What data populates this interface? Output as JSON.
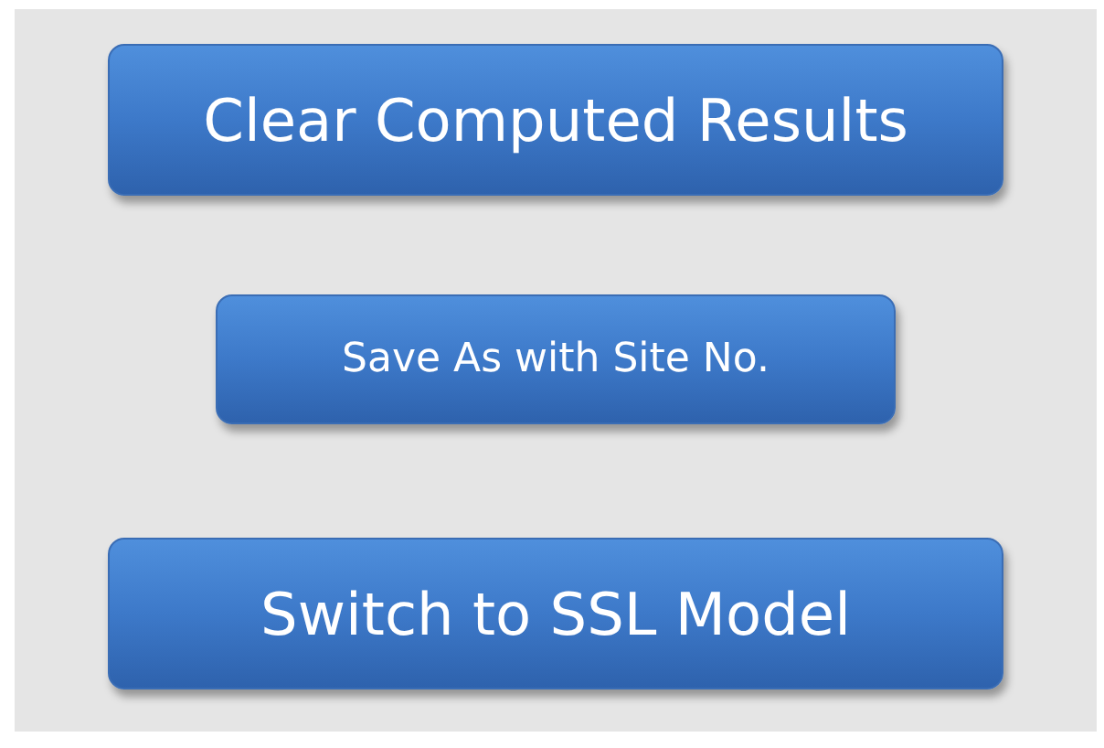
{
  "buttons": [
    {
      "label": "Clear Computed Results",
      "kind": "large"
    },
    {
      "label": "Save As with Site No.",
      "kind": "small"
    },
    {
      "label": "Switch to SSL Model",
      "kind": "large"
    }
  ]
}
